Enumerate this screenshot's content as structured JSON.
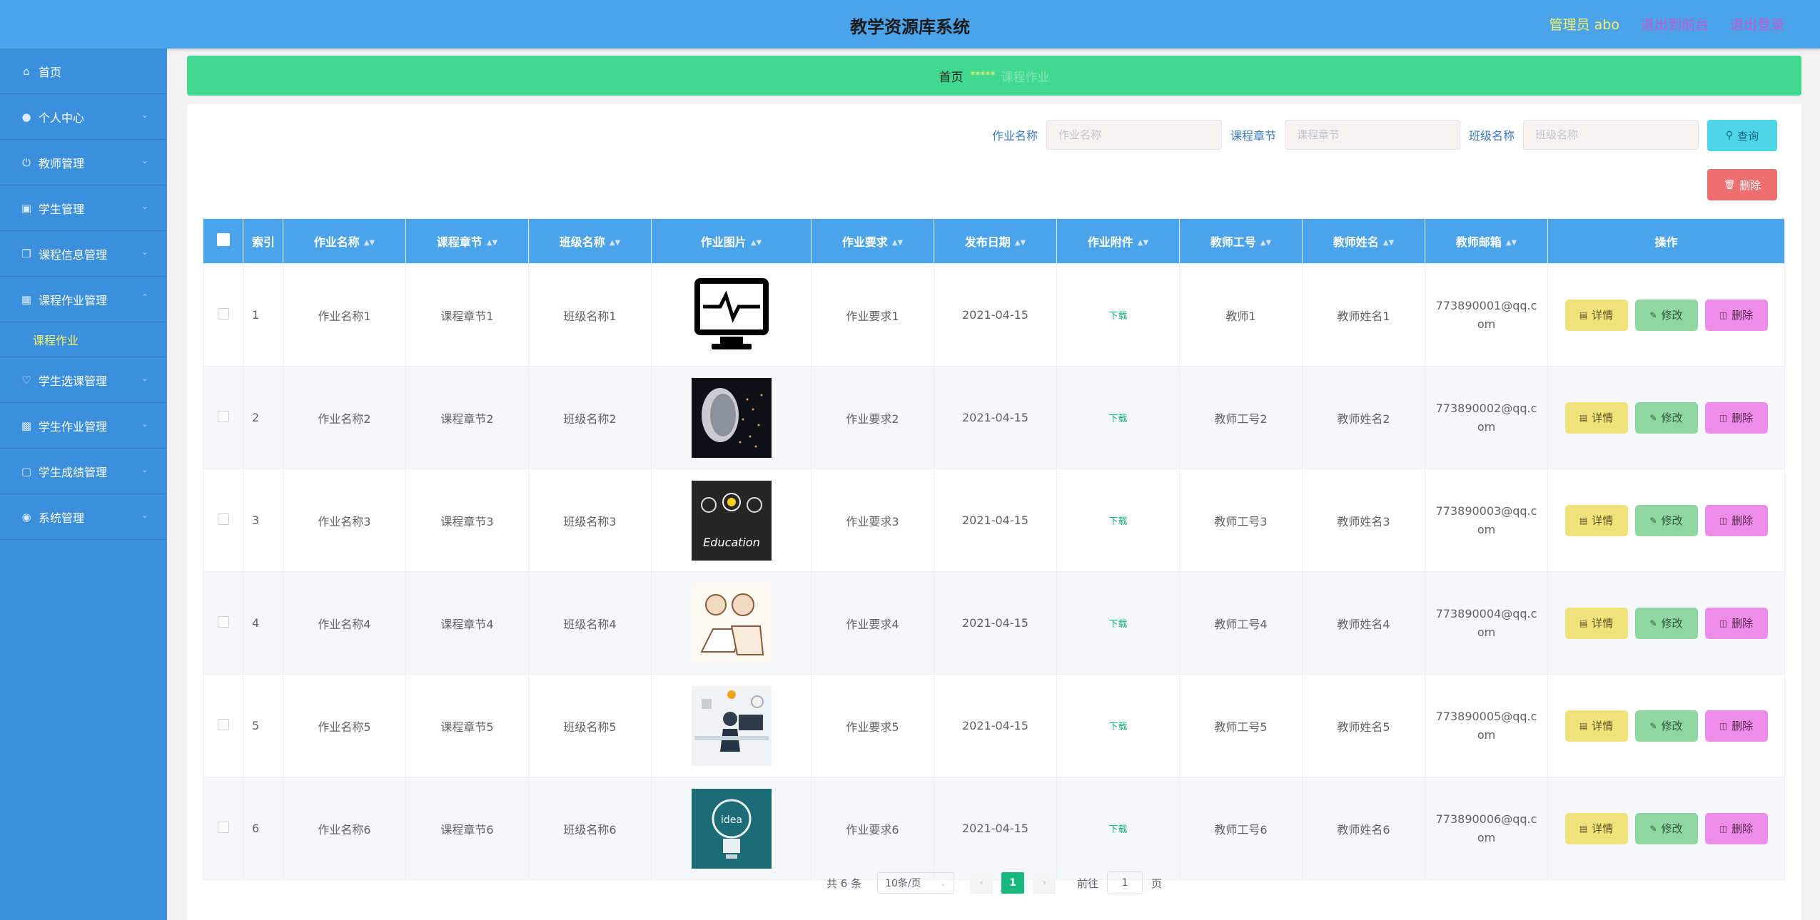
{
  "header": {
    "title": "教学资源库系统",
    "admin_label": "管理员 abo",
    "to_front": "退出到前台",
    "logout": "退出登录"
  },
  "sidebar": {
    "items": [
      {
        "label": "首页",
        "icon": "home-icon"
      },
      {
        "label": "个人中心",
        "icon": "user-icon"
      },
      {
        "label": "教师管理",
        "icon": "power-icon"
      },
      {
        "label": "学生管理",
        "icon": "briefcase-icon"
      },
      {
        "label": "课程信息管理",
        "icon": "copy-icon"
      },
      {
        "label": "课程作业管理",
        "icon": "bag-icon"
      },
      {
        "label": "学生选课管理",
        "icon": "bell-icon"
      },
      {
        "label": "学生作业管理",
        "icon": "date-icon"
      },
      {
        "label": "学生成绩管理",
        "icon": "monitor-icon"
      },
      {
        "label": "系统管理",
        "icon": "compass-icon"
      }
    ],
    "sub_item": "课程作业"
  },
  "breadcrumb": {
    "home": "首页",
    "stars": "*****",
    "current": "课程作业"
  },
  "search": {
    "f1_label": "作业名称",
    "f1_placeholder": "作业名称",
    "f2_label": "课程章节",
    "f2_placeholder": "课程章节",
    "f3_label": "班级名称",
    "f3_placeholder": "班级名称",
    "query_button": "查询",
    "delete_button": "删除"
  },
  "table": {
    "headers": {
      "index": "索引",
      "name": "作业名称",
      "chapter": "课程章节",
      "class": "班级名称",
      "image": "作业图片",
      "req": "作业要求",
      "date": "发布日期",
      "attach": "作业附件",
      "tid": "教师工号",
      "tname": "教师姓名",
      "email": "教师邮箱",
      "ops": "操作"
    },
    "rows": [
      {
        "index": "1",
        "name": "作业名称1",
        "chapter": "课程章节1",
        "class": "班级名称1",
        "req": "作业要求1",
        "date": "2021-04-15",
        "attach": "下载",
        "tid": "教师1",
        "tname": "教师姓名1",
        "email": "773890001@qq.com"
      },
      {
        "index": "2",
        "name": "作业名称2",
        "chapter": "课程章节2",
        "class": "班级名称2",
        "req": "作业要求2",
        "date": "2021-04-15",
        "attach": "下载",
        "tid": "教师工号2",
        "tname": "教师姓名2",
        "email": "773890002@qq.com"
      },
      {
        "index": "3",
        "name": "作业名称3",
        "chapter": "课程章节3",
        "class": "班级名称3",
        "req": "作业要求3",
        "date": "2021-04-15",
        "attach": "下载",
        "tid": "教师工号3",
        "tname": "教师姓名3",
        "email": "773890003@qq.com"
      },
      {
        "index": "4",
        "name": "作业名称4",
        "chapter": "课程章节4",
        "class": "班级名称4",
        "req": "作业要求4",
        "date": "2021-04-15",
        "attach": "下载",
        "tid": "教师工号4",
        "tname": "教师姓名4",
        "email": "773890004@qq.com"
      },
      {
        "index": "5",
        "name": "作业名称5",
        "chapter": "课程章节5",
        "class": "班级名称5",
        "req": "作业要求5",
        "date": "2021-04-15",
        "attach": "下载",
        "tid": "教师工号5",
        "tname": "教师姓名5",
        "email": "773890005@qq.com"
      },
      {
        "index": "6",
        "name": "作业名称6",
        "chapter": "课程章节6",
        "class": "班级名称6",
        "req": "作业要求6",
        "date": "2021-04-15",
        "attach": "下载",
        "tid": "教师工号6",
        "tname": "教师姓名6",
        "email": "773890006@qq.com"
      }
    ],
    "row_actions": {
      "detail": "详情",
      "edit": "修改",
      "delete": "删除"
    }
  },
  "pagination": {
    "total": "共 6 条",
    "page_size": "10条/页",
    "current_page": "1",
    "goto_label": "前往",
    "goto_value": "1",
    "page_suffix": "页"
  },
  "colors": {
    "topbar": "#4ba3ea",
    "sidebar": "#3b8fdc",
    "breadcrumb": "#41d98f",
    "accent": "#17b77e"
  }
}
